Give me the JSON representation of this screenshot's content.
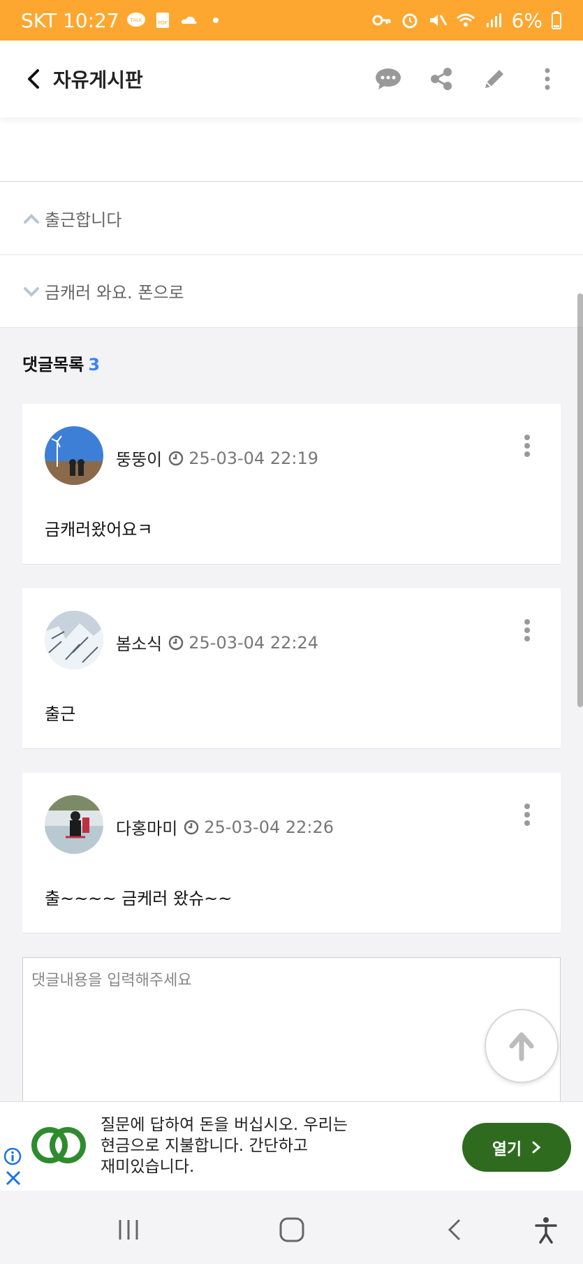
{
  "status": {
    "carrier_time": "SKT 10:27",
    "battery": "6%"
  },
  "appbar": {
    "title": "자유게시판"
  },
  "nav": {
    "prev": "출근합니다",
    "next": "금캐러 와요. 폰으로"
  },
  "comments": {
    "heading": "댓글목록",
    "count": "3",
    "items": [
      {
        "author": "뚱뚱이",
        "time": "25-03-04 22:19",
        "text": "금캐러왔어요ㅋ"
      },
      {
        "author": "봄소식",
        "time": "25-03-04 22:24",
        "text": "출근"
      },
      {
        "author": "다홍마미",
        "time": "25-03-04 22:26",
        "text": "출~~~~ 금케러 왔슈~~"
      }
    ]
  },
  "reply": {
    "placeholder": "댓글내용을 입력해주세요"
  },
  "ad": {
    "line1": "질문에 답하여 돈을 버십시오. 우리는",
    "line2": "현금으로 지불합니다. 간단하고",
    "line3": "재미있습니다.",
    "button": "열기"
  },
  "colors": {
    "status_bar": "#fda731",
    "accent_count": "#3b82f6",
    "ad_button": "#2e6b1f"
  }
}
